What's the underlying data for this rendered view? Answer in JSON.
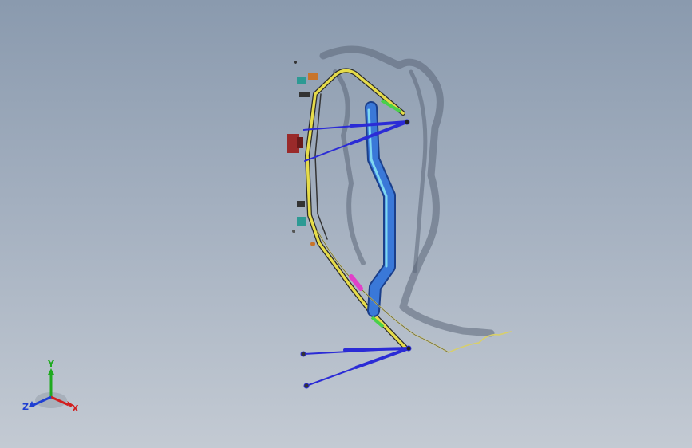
{
  "viewport": {
    "background_top": "#8a9aae",
    "background_bottom": "#c3cad3"
  },
  "model": {
    "frame_color": "#e6dc4a",
    "tube_color": "#3a78d8",
    "tube_highlight": "#7fd8f0",
    "strut_color": "#2b2bd6",
    "shadow_color": "#5b6678",
    "cable_color": "#d8cf6a",
    "accent_pink": "#e040c8",
    "accent_red": "#9a2a2a",
    "accent_teal": "#2d9a94",
    "accent_green": "#4ad04a"
  },
  "triad": {
    "y_label": "Y",
    "x_label": "X",
    "z_label": "Z",
    "y_color": "#1faa1f",
    "x_color": "#d21f1f",
    "z_color": "#1f3fd2",
    "icon": "coordinate-triad-icon"
  }
}
